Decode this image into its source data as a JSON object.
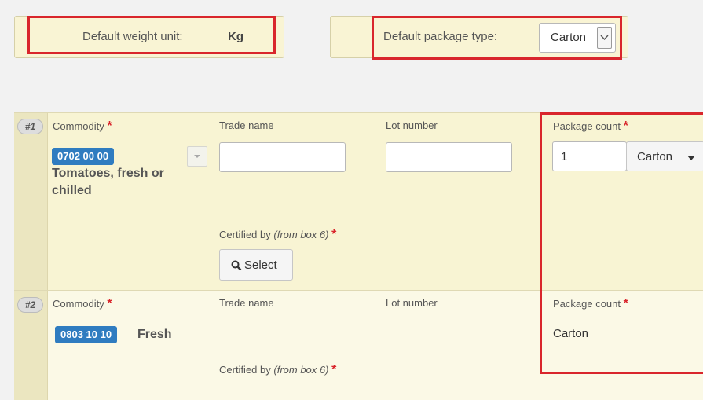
{
  "defaults": {
    "weight_label": "Default weight unit:",
    "weight_value": "Kg",
    "package_label": "Default package type:",
    "package_value": "Carton"
  },
  "rows": [
    {
      "number": "#1",
      "commodity_label": "Commodity",
      "cn_code": "0702 00 00",
      "cn_description": "Tomatoes, fresh or chilled",
      "trade_name_label": "Trade name",
      "trade_name_value": "",
      "lot_number_label": "Lot number",
      "lot_number_value": "",
      "package_count_label": "Package count",
      "package_count_value": "1",
      "package_type": "Carton",
      "certified_by_label": "Certified by",
      "certified_by_note": "(from box 6)",
      "select_button": "Select"
    },
    {
      "number": "#2",
      "commodity_label": "Commodity",
      "cn_code": "0803 10 10",
      "cn_description": "Fresh",
      "trade_name_label": "Trade name",
      "lot_number_label": "Lot number",
      "package_count_label": "Package count",
      "package_type": "Carton",
      "certified_by_label": "Certified by",
      "certified_by_note": "(from box 6)"
    }
  ],
  "required_marker": "*",
  "icons": [
    "chevron-down-icon",
    "caret-down-icon",
    "search-icon"
  ],
  "colors": {
    "highlight": "#d9262c",
    "badge": "#2f7cc0",
    "panel": "#f9f4d4"
  }
}
